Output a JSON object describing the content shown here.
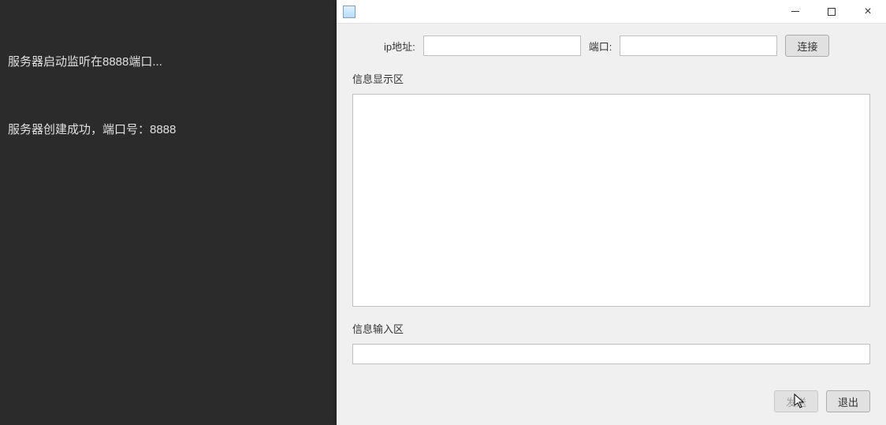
{
  "console": {
    "line1": "服务器启动监听在8888端口...",
    "line2": "服务器创建成功，端口号：8888"
  },
  "window": {
    "conn": {
      "ip_label": "ip地址:",
      "ip_value": "",
      "port_label": "端口:",
      "port_value": "",
      "connect_btn": "连接"
    },
    "display": {
      "section_label": "信息显示区",
      "content": ""
    },
    "input": {
      "section_label": "信息输入区",
      "value": ""
    },
    "buttons": {
      "send": "发送",
      "exit": "退出"
    }
  }
}
